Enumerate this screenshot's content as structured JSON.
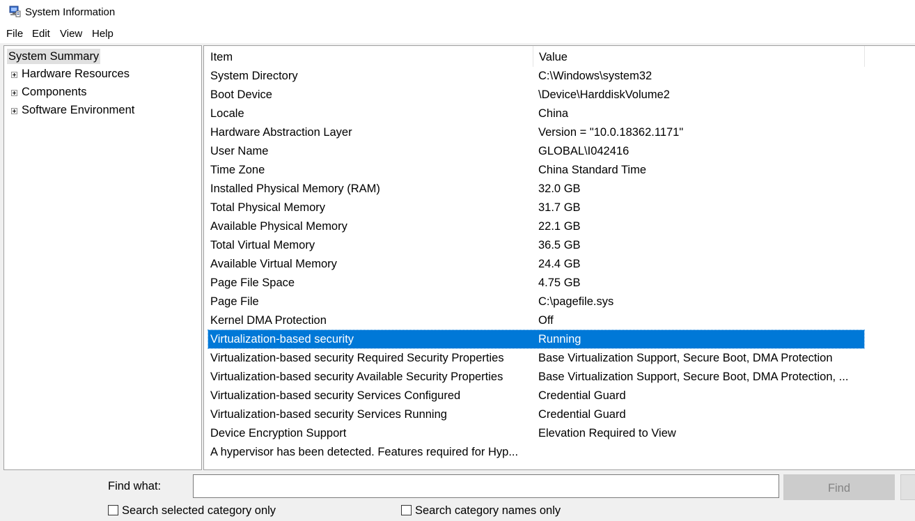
{
  "window": {
    "title": "System Information",
    "app_icon": "system-information-icon"
  },
  "menu": [
    "File",
    "Edit",
    "View",
    "Help"
  ],
  "tree": {
    "selected": "System Summary",
    "items": [
      "Hardware Resources",
      "Components",
      "Software Environment"
    ],
    "expander_icon": "plus-expander-icon"
  },
  "list": {
    "columns": [
      "Item",
      "Value"
    ],
    "rows": [
      {
        "item": "System Directory",
        "value": "C:\\Windows\\system32"
      },
      {
        "item": "Boot Device",
        "value": "\\Device\\HarddiskVolume2"
      },
      {
        "item": "Locale",
        "value": "China"
      },
      {
        "item": "Hardware Abstraction Layer",
        "value": "Version = \"10.0.18362.1171\""
      },
      {
        "item": "User Name",
        "value": "GLOBAL\\I042416"
      },
      {
        "item": "Time Zone",
        "value": "China Standard Time"
      },
      {
        "item": "Installed Physical Memory (RAM)",
        "value": "32.0 GB"
      },
      {
        "item": "Total Physical Memory",
        "value": "31.7 GB"
      },
      {
        "item": "Available Physical Memory",
        "value": "22.1 GB"
      },
      {
        "item": "Total Virtual Memory",
        "value": "36.5 GB"
      },
      {
        "item": "Available Virtual Memory",
        "value": "24.4 GB"
      },
      {
        "item": "Page File Space",
        "value": "4.75 GB"
      },
      {
        "item": "Page File",
        "value": "C:\\pagefile.sys"
      },
      {
        "item": "Kernel DMA Protection",
        "value": "Off"
      },
      {
        "item": "Virtualization-based security",
        "value": "Running"
      },
      {
        "item": "Virtualization-based security Required Security Properties",
        "value": "Base Virtualization Support, Secure Boot, DMA Protection"
      },
      {
        "item": "Virtualization-based security Available Security Properties",
        "value": "Base Virtualization Support, Secure Boot, DMA Protection, ..."
      },
      {
        "item": "Virtualization-based security Services Configured",
        "value": "Credential Guard"
      },
      {
        "item": "Virtualization-based security Services Running",
        "value": "Credential Guard"
      },
      {
        "item": "Device Encryption Support",
        "value": "Elevation Required to View"
      },
      {
        "item": "A hypervisor has been detected. Features required for Hyp...",
        "value": ""
      }
    ],
    "selected_row": 14,
    "selection_color": "#0078d7"
  },
  "find": {
    "label": "Find what:",
    "value": "",
    "button_label": "Find",
    "checkbox_selected_category": "Search selected category only",
    "checkbox_category_names": "Search category names only"
  }
}
